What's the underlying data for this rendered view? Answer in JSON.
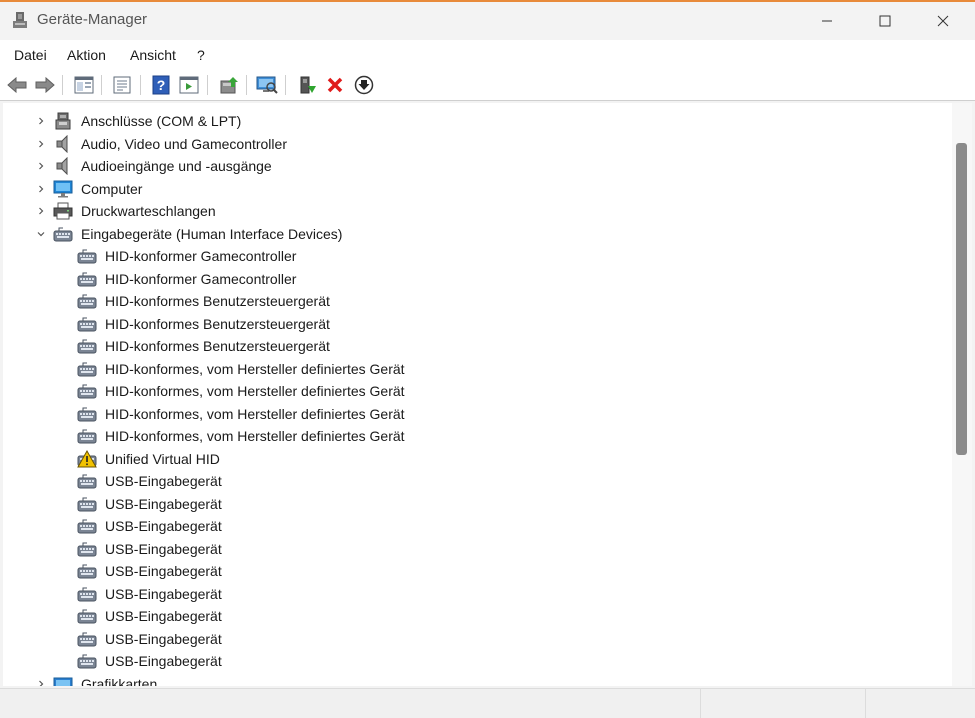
{
  "window": {
    "title": "Geräte-Manager"
  },
  "menu": [
    "Datei",
    "Aktion",
    "Ansicht",
    "?"
  ],
  "toolbar": {
    "buttons": [
      "back-arrow-icon",
      "forward-arrow-icon",
      "properties-panel-icon",
      "properties-icon",
      "help-icon",
      "run-icon",
      "update-driver-icon",
      "scan-hardware-icon",
      "enable-device-icon",
      "uninstall-icon",
      "download-icon"
    ]
  },
  "tree": {
    "top_items": [
      {
        "label": "Anschlüsse (COM & LPT)",
        "icon": "port-icon",
        "expanded": false
      },
      {
        "label": "Audio, Video und Gamecontroller",
        "icon": "speaker-icon",
        "expanded": false
      },
      {
        "label": "Audioeingänge und -ausgänge",
        "icon": "speaker-icon",
        "expanded": false
      },
      {
        "label": "Computer",
        "icon": "monitor-icon",
        "expanded": false
      },
      {
        "label": "Druckwarteschlangen",
        "icon": "printer-icon",
        "expanded": false
      },
      {
        "label": "Eingabegeräte (Human Interface Devices)",
        "icon": "hid-icon",
        "expanded": true
      }
    ],
    "children": [
      {
        "label": "HID-konformer Gamecontroller",
        "icon": "hid-icon"
      },
      {
        "label": "HID-konformer Gamecontroller",
        "icon": "hid-icon"
      },
      {
        "label": "HID-konformes Benutzersteuergerät",
        "icon": "hid-icon"
      },
      {
        "label": "HID-konformes Benutzersteuergerät",
        "icon": "hid-icon"
      },
      {
        "label": "HID-konformes Benutzersteuergerät",
        "icon": "hid-icon"
      },
      {
        "label": "HID-konformes, vom Hersteller definiertes Gerät",
        "icon": "hid-icon"
      },
      {
        "label": "HID-konformes, vom Hersteller definiertes Gerät",
        "icon": "hid-icon"
      },
      {
        "label": "HID-konformes, vom Hersteller definiertes Gerät",
        "icon": "hid-icon"
      },
      {
        "label": "HID-konformes, vom Hersteller definiertes Gerät",
        "icon": "hid-icon"
      },
      {
        "label": "Unified Virtual HID",
        "icon": "warning-icon"
      },
      {
        "label": "USB-Eingabegerät",
        "icon": "hid-icon"
      },
      {
        "label": "USB-Eingabegerät",
        "icon": "hid-icon"
      },
      {
        "label": "USB-Eingabegerät",
        "icon": "hid-icon"
      },
      {
        "label": "USB-Eingabegerät",
        "icon": "hid-icon"
      },
      {
        "label": "USB-Eingabegerät",
        "icon": "hid-icon"
      },
      {
        "label": "USB-Eingabegerät",
        "icon": "hid-icon"
      },
      {
        "label": "USB-Eingabegerät",
        "icon": "hid-icon"
      },
      {
        "label": "USB-Eingabegerät",
        "icon": "hid-icon"
      },
      {
        "label": "USB-Eingabegerät",
        "icon": "hid-icon"
      }
    ],
    "after_items": [
      {
        "label": "Grafikkarten",
        "icon": "display-adapter-icon",
        "expanded": false
      }
    ]
  },
  "colors": {
    "accent": "#e88a3a",
    "warning": "#f2c200",
    "link_blue": "#1e6fd9"
  }
}
